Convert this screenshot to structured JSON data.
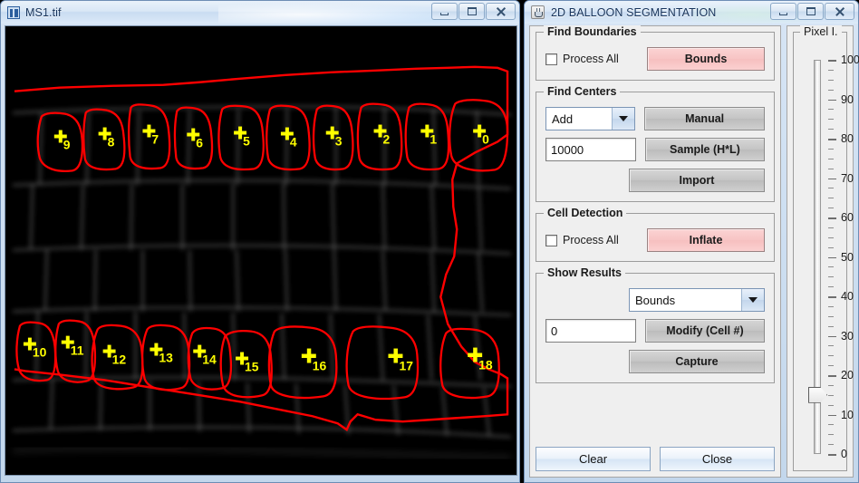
{
  "image_window": {
    "title": "MS1.tif",
    "app_icon": "imagej-icon",
    "window_buttons": [
      "minimize",
      "maximize",
      "close"
    ],
    "segmentation": {
      "boundary_color": "#ff0000",
      "marker_color": "#ffff00",
      "background_color": "#000000",
      "top_row_labels": [
        "9",
        "8",
        "7",
        "6",
        "5",
        "4",
        "3",
        "2",
        "1",
        "0"
      ],
      "bottom_row_labels": [
        "10",
        "11",
        "12",
        "13",
        "14",
        "15",
        "16",
        "17",
        "18"
      ]
    }
  },
  "tool_window": {
    "title": "2D BALLOON SEGMENTATION",
    "app_icon": "java-coffee-cup-icon",
    "window_buttons": [
      "minimize",
      "maximize",
      "close"
    ],
    "find_boundaries": {
      "legend": "Find Boundaries",
      "process_all_label": "Process All",
      "process_all_checked": false,
      "bounds_button": "Bounds",
      "bounds_button_color": "#f7c4c4"
    },
    "find_centers": {
      "legend": "Find Centers",
      "mode_select_value": "Add",
      "manual_button": "Manual",
      "size_value": "10000",
      "sample_button": "Sample (H*L)",
      "import_button": "Import"
    },
    "cell_detection": {
      "legend": "Cell Detection",
      "process_all_label": "Process All",
      "process_all_checked": false,
      "inflate_button": "Inflate",
      "inflate_button_color": "#f7c4c4"
    },
    "show_results": {
      "legend": "Show Results",
      "result_select_value": "Bounds",
      "cell_number_value": "0",
      "modify_button": "Modify (Cell #)",
      "capture_button": "Capture"
    },
    "footer": {
      "clear_button": "Clear",
      "close_button": "Close"
    },
    "pixel_slider": {
      "legend": "Pixel I.",
      "min": 0,
      "max": 100,
      "value": 15,
      "major_labels": [
        "100",
        "90",
        "80",
        "70",
        "60",
        "50",
        "40",
        "30",
        "20",
        "10",
        "0"
      ],
      "major_values": [
        100,
        90,
        80,
        70,
        60,
        50,
        40,
        30,
        20,
        10,
        0
      ],
      "minor_step": 2.5
    }
  }
}
